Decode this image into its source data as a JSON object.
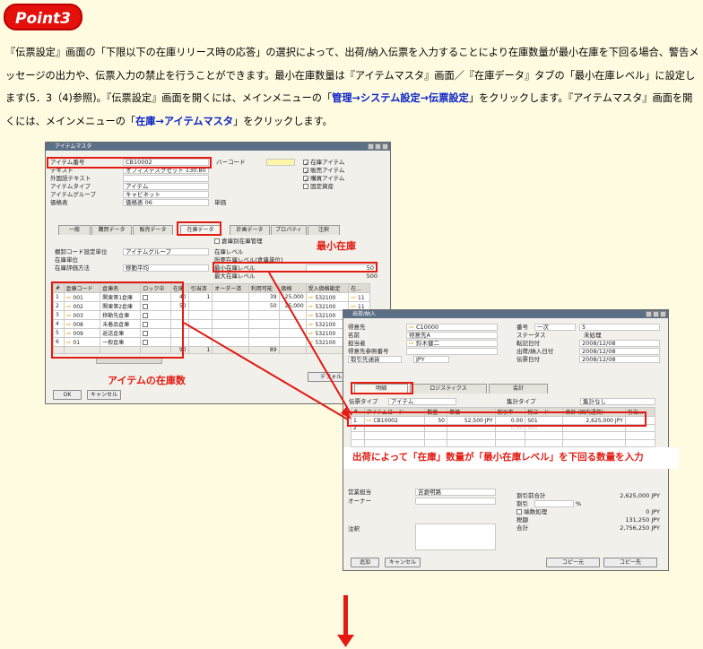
{
  "point_label": "Point3",
  "paragraph": {
    "seg1": "『伝票設定』画面の「下限以下の在庫リリース時の応答」の選択によって、出荷/納入伝票を入力することにより在庫数量が最小在庫を下回る場合、警告メッセージの出力や、伝票入力の禁止を行うことができます。最小在庫数量は『アイテムマスタ』画面／『在庫データ』タブの「最小在庫レベル」に設定します(5．3（4)参照)。『伝票設定』画面を開くには、メインメニューの「",
    "hl1": "管理→システム設定→伝票設定",
    "seg2": "」をクリックします。『アイテムマスタ』画面を開くには、メインメニューの「",
    "hl2": "在庫→アイテムマスタ",
    "seg3": "」をクリックします。"
  },
  "item_master": {
    "title": "アイテムマスタ",
    "fields": {
      "item_no_label": "アイテム番号",
      "item_no": "CB10002",
      "desc_label": "テキスト",
      "desc": "オフィスデスクセット 130.80",
      "foreign_label": "外国語テキスト",
      "foreign": "",
      "type_label": "アイテムタイプ",
      "type": "アイテム",
      "group_label": "アイテムグループ",
      "group": "キャビネット",
      "price_label": "価格表",
      "price": "価格表 06",
      "barcode_label": "バーコード",
      "unit_price_label": "単価"
    },
    "checks": [
      "在庫アイテム",
      "販売アイテム",
      "購買アイテム",
      "固定資産"
    ],
    "tabs": [
      "一般",
      "購買データ",
      "販売データ",
      "在庫データ",
      "計画データ",
      "プロパティ",
      "注釈"
    ],
    "active_tab": "在庫データ",
    "inv": {
      "method_label": "棚卸コード設定単位",
      "method": "アイテムグループ",
      "uom_label": "在庫単位",
      "eval_label": "在庫評価方法",
      "eval": "移動平均",
      "per_wh_label": "倉庫別在庫管理",
      "level_label": "在庫レベル",
      "req_label": "所要在庫レベル(倉庫単位)",
      "min_label": "最小在庫レベル",
      "min_value": "50",
      "max_label": "最大在庫レベル",
      "max_value": "500"
    },
    "table_headers": [
      "#",
      "倉庫コード",
      "倉庫名",
      "ロック中",
      "在庫",
      "引当済",
      "オーダー済",
      "利用可能",
      "価格",
      "受入価格勘定",
      "在..."
    ],
    "rows": [
      {
        "n": "1",
        "code": "001",
        "name": "関東第1倉庫",
        "stock": "40",
        "committed": "1",
        "available": "39",
        "price": "25,000",
        "acct": "532100",
        "last": "11"
      },
      {
        "n": "2",
        "code": "002",
        "name": "関東第2倉庫",
        "stock": "50",
        "committed": "",
        "available": "50",
        "price": "25,000",
        "acct": "532100",
        "last": "11"
      },
      {
        "n": "3",
        "code": "003",
        "name": "移動先倉庫",
        "stock": "",
        "committed": "",
        "available": "",
        "price": "",
        "acct": "532100",
        "last": ""
      },
      {
        "n": "4",
        "code": "008",
        "name": "未着品倉庫",
        "stock": "",
        "committed": "",
        "available": "",
        "price": "",
        "acct": "532100",
        "last": ""
      },
      {
        "n": "5",
        "code": "009",
        "name": "返送倉庫",
        "stock": "",
        "committed": "",
        "available": "",
        "price": "",
        "acct": "532100",
        "last": ""
      },
      {
        "n": "6",
        "code": "01",
        "name": "一般倉庫",
        "stock": "",
        "committed": "",
        "available": "",
        "price": "",
        "acct": "532100",
        "last": ""
      }
    ],
    "totals": {
      "stock": "90",
      "committed": "1",
      "available": "89"
    },
    "ok_label": "OK",
    "cancel_label": "キャンセル",
    "default_label": "デフォルト倉..."
  },
  "delivery": {
    "title": "出荷/納入",
    "left": {
      "partner_label": "得意先",
      "partner": "C10000",
      "name_label": "名前",
      "name": "得意先A",
      "contact_label": "担当者",
      "contact": "鈴木健二",
      "ref_label": "得意先参照番号",
      "ref": "",
      "currency_label": "取引先通貨",
      "currency": "JPY"
    },
    "right": {
      "no_label": "番号",
      "series": "一次",
      "no": "5",
      "status_label": "ステータス",
      "status": "未処理",
      "post_label": "転記日付",
      "post": "2008/12/08",
      "ship_label": "出荷/納入日付",
      "ship": "2008/12/08",
      "doc_label": "伝票日付",
      "doc": "2008/12/08"
    },
    "tabs": [
      "明細",
      "ロジスティクス",
      "会計"
    ],
    "type_label": "伝票タイプ",
    "type": "アイテム",
    "summary_label": "集計タイプ",
    "summary": "集計なし",
    "table_headers": [
      "#",
      "アイテムコード",
      "数量",
      "単価",
      "割引率",
      "税コード",
      "合計 (国内通貨)",
      "引当..."
    ],
    "rows": [
      {
        "n": "1",
        "code": "CB10002",
        "qty": "50",
        "price": "52,500 JPY",
        "disc": "0.00",
        "tax": "S01",
        "total": "2,625,000 JPY"
      },
      {
        "n": "2",
        "code": "",
        "qty": "",
        "price": "",
        "disc": "0.00",
        "tax": "S01",
        "total": ""
      }
    ],
    "bottom": {
      "sales_label": "営業担当",
      "sales": "吉倉明路",
      "owner_label": "オーナー",
      "note_label": "注釈",
      "before_disc_label": "割引前合計",
      "before_disc": "2,625,000 JPY",
      "disc_label": "割引",
      "disc_pct": "%",
      "round_label": "端数処理",
      "round": "0 JPY",
      "tax_label": "税額",
      "tax": "131,250 JPY",
      "total_label": "合計",
      "total": "2,756,250 JPY"
    },
    "add_label": "追加",
    "cancel_label": "キャンセル",
    "copy_from_label": "コピー元",
    "copy_to_label": "コピー先"
  },
  "annotations": {
    "min_stock": "最小在庫",
    "item_stock": "アイテムの在庫数",
    "callout": "出荷によって「在庫」数量が「最小在庫レベル」を下回る数量を入力"
  }
}
